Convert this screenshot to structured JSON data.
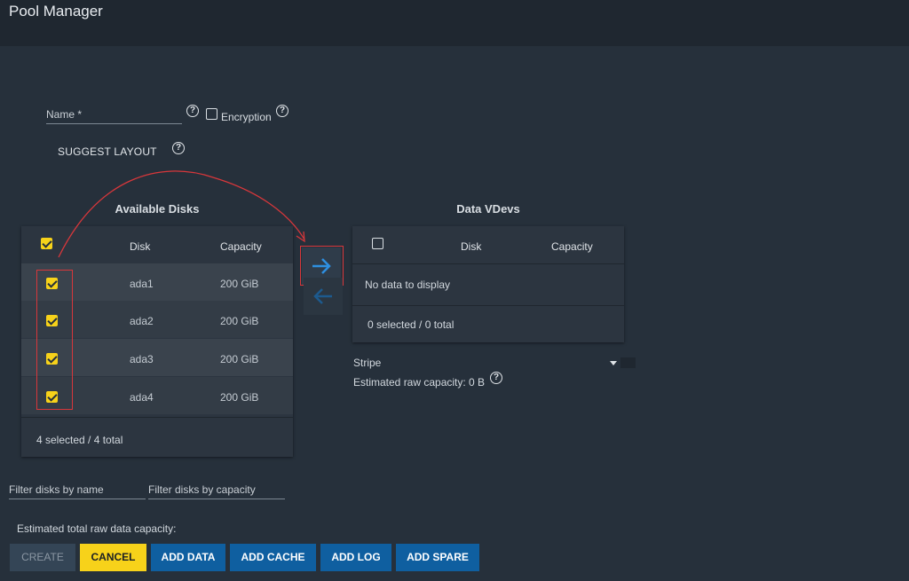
{
  "header": {
    "title": "Pool Manager"
  },
  "form": {
    "name_label": "Name *",
    "encryption_label": "Encryption",
    "suggest_layout_label": "SUGGEST LAYOUT"
  },
  "available": {
    "title": "Available Disks",
    "col_disk": "Disk",
    "col_capacity": "Capacity",
    "rows": [
      {
        "disk": "ada1",
        "capacity": "200 GiB",
        "checked": true
      },
      {
        "disk": "ada2",
        "capacity": "200 GiB",
        "checked": true
      },
      {
        "disk": "ada3",
        "capacity": "200 GiB",
        "checked": true
      },
      {
        "disk": "ada4",
        "capacity": "200 GiB",
        "checked": true
      }
    ],
    "footer": "4 selected / 4 total"
  },
  "vdevs": {
    "title": "Data VDevs",
    "col_disk": "Disk",
    "col_capacity": "Capacity",
    "empty_text": "No data to display",
    "footer": "0 selected / 0 total",
    "layout_value": "Stripe",
    "estimated_raw": "Estimated raw capacity: 0 B"
  },
  "filters": {
    "by_name": "Filter disks by name",
    "by_capacity": "Filter disks by capacity"
  },
  "estimated_total": "Estimated total raw data capacity:",
  "buttons": {
    "create": "CREATE",
    "cancel": "CANCEL",
    "add_data": "ADD DATA",
    "add_cache": "ADD CACHE",
    "add_log": "ADD LOG",
    "add_spare": "ADD SPARE"
  },
  "icons": {
    "help": "help-circle-icon",
    "move_right": "arrow-right-icon",
    "move_left": "arrow-left-icon",
    "dropdown": "caret-down-icon"
  },
  "colors": {
    "accent_yellow": "#f7d21a",
    "primary_blue": "#0f5fa0",
    "annotation_red": "#d8373b"
  }
}
